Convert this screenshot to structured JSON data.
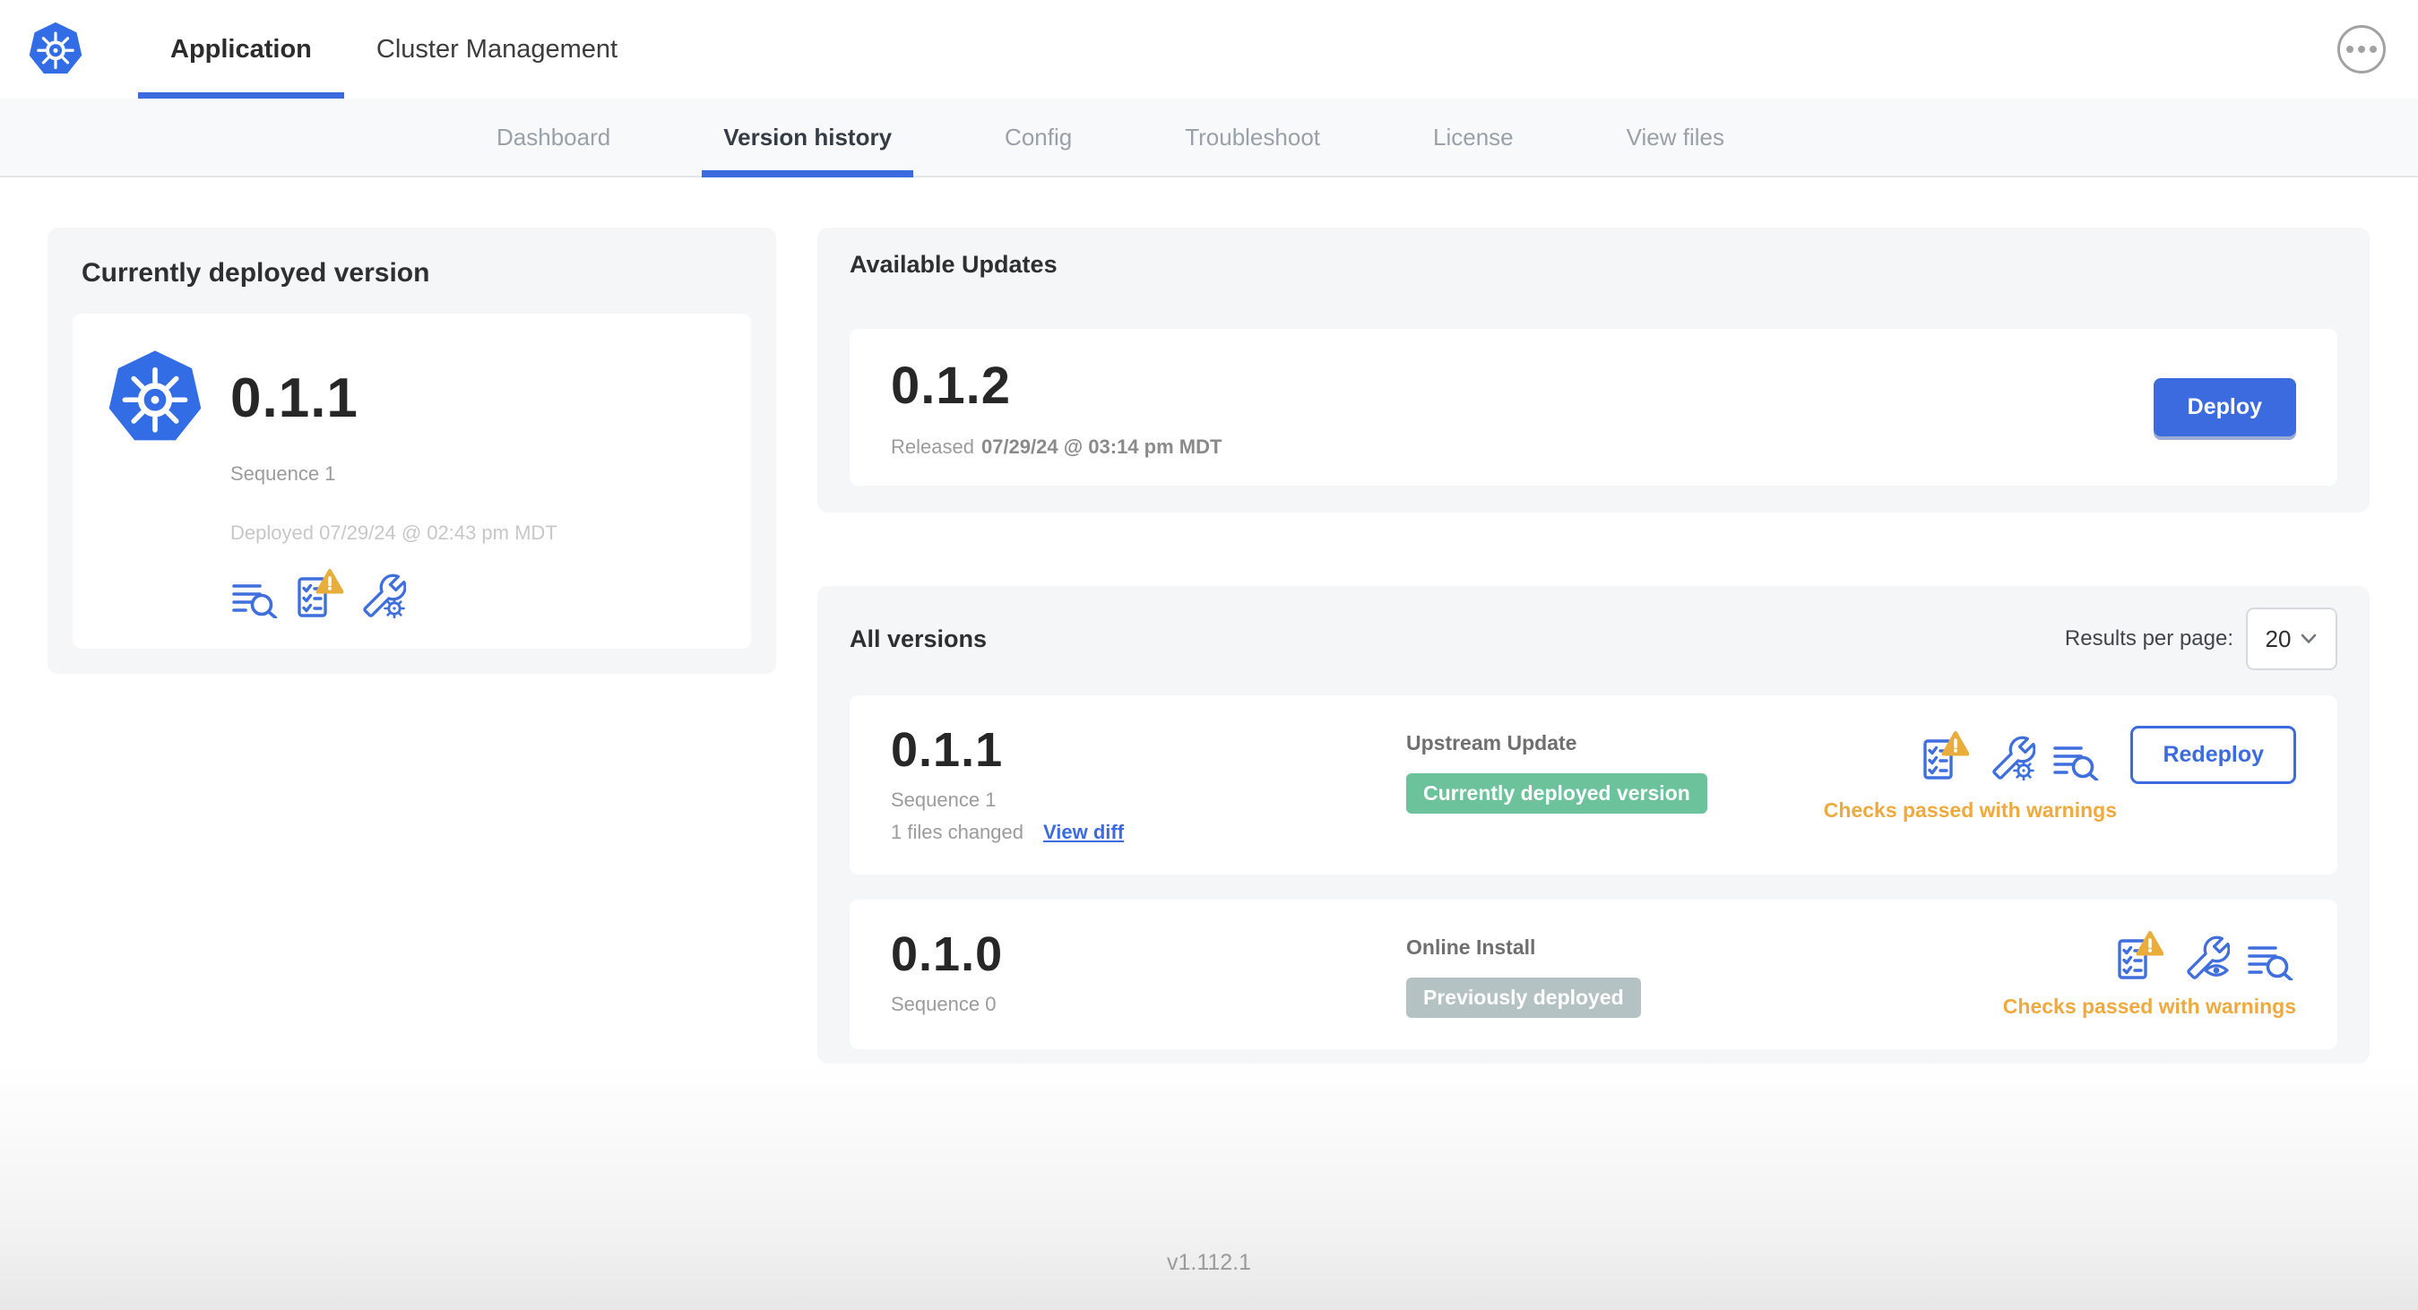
{
  "header": {
    "tabs": [
      {
        "label": "Application",
        "active": true
      },
      {
        "label": "Cluster Management",
        "active": false
      }
    ]
  },
  "subnav": {
    "tabs": [
      {
        "label": "Dashboard",
        "active": false
      },
      {
        "label": "Version history",
        "active": true
      },
      {
        "label": "Config",
        "active": false
      },
      {
        "label": "Troubleshoot",
        "active": false
      },
      {
        "label": "License",
        "active": false
      },
      {
        "label": "View files",
        "active": false
      }
    ]
  },
  "current": {
    "title": "Currently deployed version",
    "version": "0.1.1",
    "sequence": "Sequence 1",
    "deployed": "Deployed 07/29/24 @ 02:43 pm MDT",
    "icons": [
      "diff-lines-magnifier-icon",
      "preflight-checklist-warning-icon",
      "wrench-gear-icon"
    ]
  },
  "available": {
    "title": "Available Updates",
    "version": "0.1.2",
    "released_prefix": "Released",
    "released_date": "07/29/24 @ 03:14 pm MDT",
    "deploy_label": "Deploy"
  },
  "versions": {
    "title": "All versions",
    "results_per_page_label": "Results per page:",
    "results_per_page_value": "20",
    "rows": [
      {
        "version": "0.1.1",
        "sequence": "Sequence 1",
        "files_changed": "1 files changed",
        "view_diff_label": "View diff",
        "source": "Upstream Update",
        "badge_label": "Currently deployed version",
        "badge_color": "#6cc39b",
        "status": "Checks passed with warnings",
        "action_label": "Redeploy",
        "icons": [
          "preflight-checklist-warning-icon",
          "wrench-gear-icon",
          "diff-lines-magnifier-icon"
        ]
      },
      {
        "version": "0.1.0",
        "sequence": "Sequence 0",
        "source": "Online Install",
        "badge_label": "Previously deployed",
        "badge_color": "#b5c2c4",
        "status": "Checks passed with warnings",
        "icons": [
          "preflight-checklist-warning-icon",
          "wrench-eye-icon",
          "diff-lines-magnifier-icon"
        ]
      }
    ]
  },
  "footer": {
    "version": "v1.112.1"
  },
  "colors": {
    "accent_blue": "#3b6bdf",
    "kubernetes_blue": "#326de6",
    "badge_green": "#6cc39b",
    "badge_gray": "#b5c2c4",
    "warning_orange": "#efa93c",
    "warning_triangle": "#e8ad3a",
    "panel_gray": "#f4f6f8",
    "subnav_gray": "#f8f9fa"
  }
}
